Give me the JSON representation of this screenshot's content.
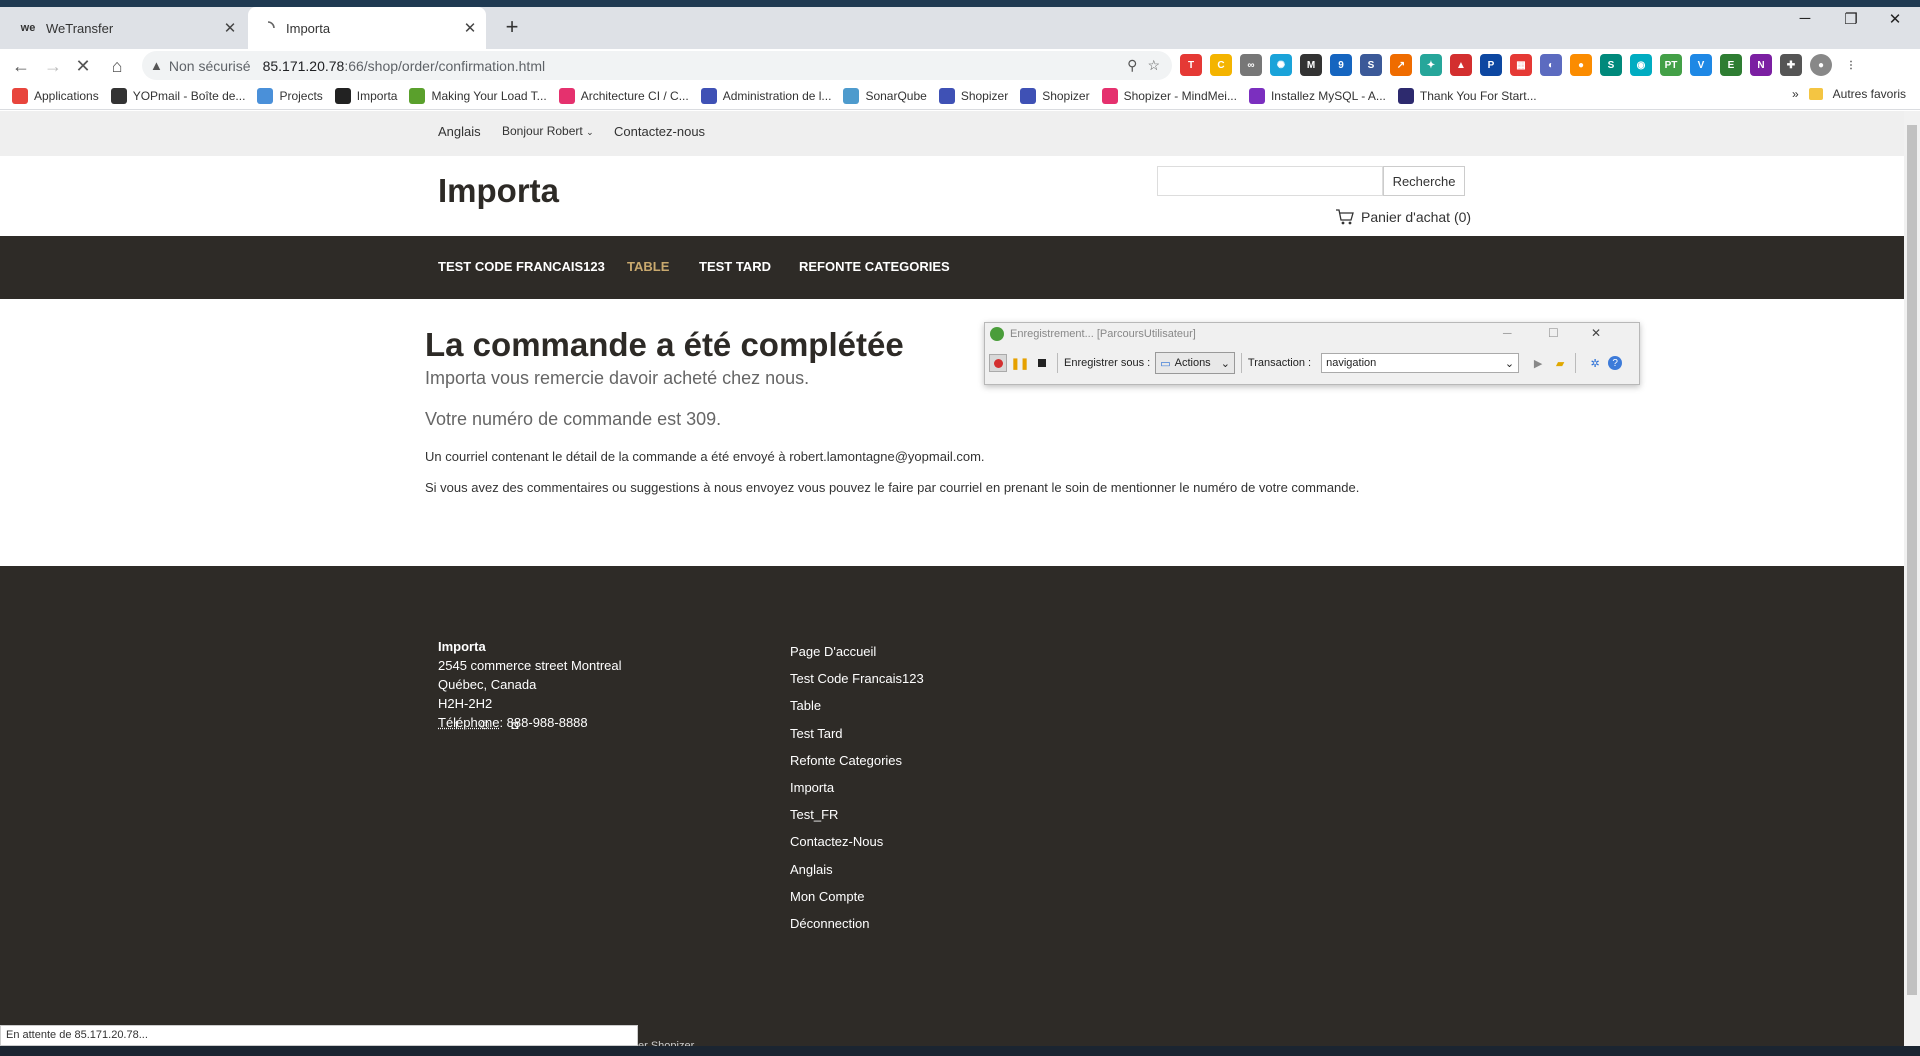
{
  "browser": {
    "tabs": [
      {
        "title": "WeTransfer",
        "favicon": "we"
      },
      {
        "title": "Importa",
        "favicon": "loading"
      }
    ],
    "address": {
      "security": "Non sécurisé",
      "host": "85.171.20.78",
      "path": ":66/shop/order/confirmation.html"
    },
    "bookmarks": [
      {
        "label": "Applications",
        "color": "#e8453c"
      },
      {
        "label": "YOPmail - Boîte de...",
        "color": "#333333"
      },
      {
        "label": "Projects",
        "color": "#4a90d9"
      },
      {
        "label": "Importa",
        "color": "#222222"
      },
      {
        "label": "Making Your Load T...",
        "color": "#5aa02c"
      },
      {
        "label": "Architecture CI / C...",
        "color": "#e5316e"
      },
      {
        "label": "Administration de l...",
        "color": "#3f51b5"
      },
      {
        "label": "SonarQube",
        "color": "#4e9bcd"
      },
      {
        "label": "Shopizer",
        "color": "#3f51b5"
      },
      {
        "label": "Shopizer",
        "color": "#3f51b5"
      },
      {
        "label": "Shopizer - MindMei...",
        "color": "#e5316e"
      },
      {
        "label": "Installez MySQL - A...",
        "color": "#7b2fbf"
      },
      {
        "label": "Thank You For Start...",
        "color": "#2d2a6e"
      }
    ],
    "bookmarks_more": "»",
    "other_bookmarks": "Autres favoris",
    "status_text": "En attente de 85.171.20.78..."
  },
  "site": {
    "topbar": {
      "language": "Anglais",
      "greeting": "Bonjour Robert",
      "contact": "Contactez-nous"
    },
    "logo": "Importa",
    "search_button": "Recherche",
    "cart": "Panier d'achat (0)",
    "nav": [
      "TEST CODE FRANCAIS123",
      "TABLE",
      "TEST TARD",
      "REFONTE CATEGORIES"
    ],
    "confirmation": {
      "title": "La commande a été complétée",
      "thanks": "Importa vous remercie davoir acheté chez nous.",
      "order_number": "Votre numéro de commande est 309.",
      "email_note": "Un courriel contenant le détail de la commande a été envoyé à robert.lamontagne@yopmail.com.",
      "comments_note": "Si vous avez des commentaires ou suggestions à nous envoyez vous pouvez le faire par courriel en prenant le soin de mentionner le numéro de votre commande."
    },
    "footer": {
      "company": "Importa",
      "street": "2545 commerce street Montreal",
      "region": "Québec, Canada",
      "postal": "H2H-2H2",
      "phone_label": "Téléphone",
      "phone": ": 888-988-8888",
      "links": [
        "Page D'accueil",
        "Test Code Francais123",
        "Table",
        "Test Tard",
        "Refonte Categories",
        "Importa",
        "Test_FR",
        "Contactez-Nous",
        "Anglais",
        "Mon Compte",
        "Déconnection"
      ],
      "bottom_partial": "er Shopizer"
    }
  },
  "recorder": {
    "title": "Enregistrement... [ParcoursUtilisateur]",
    "save_as_label": "Enregistrer sous :",
    "actions_label": "Actions",
    "transaction_label": "Transaction :",
    "transaction_value": "navigation"
  },
  "colors": {
    "nav_active": "#c9a96e",
    "dark": "#2e2b27"
  }
}
